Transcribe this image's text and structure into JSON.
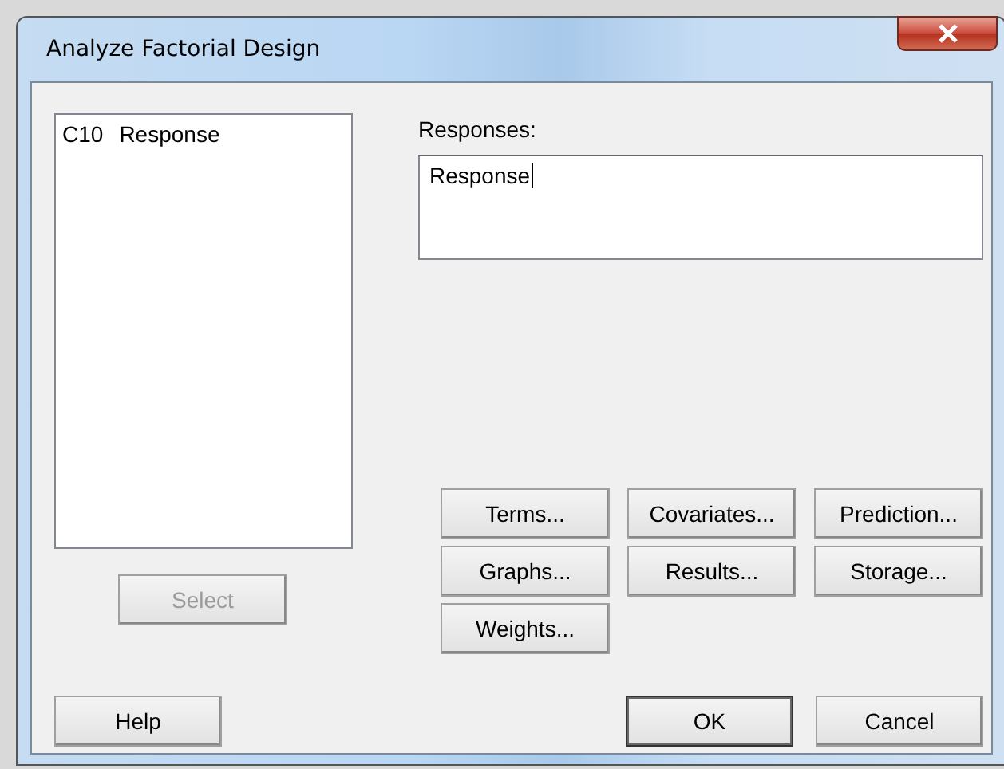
{
  "window": {
    "title": "Analyze Factorial Design"
  },
  "variables": [
    {
      "column": "C10",
      "name": "Response",
      "selected": false
    }
  ],
  "select_button": {
    "label": "Select",
    "disabled": true
  },
  "responses": {
    "label": "Responses:",
    "value": "Response"
  },
  "option_buttons": [
    {
      "label": "Terms..."
    },
    {
      "label": "Covariates..."
    },
    {
      "label": "Prediction..."
    },
    {
      "label": "Graphs..."
    },
    {
      "label": "Results..."
    },
    {
      "label": "Storage..."
    },
    {
      "label": "Weights..."
    }
  ],
  "help_button": {
    "label": "Help",
    "default": false
  },
  "footer_buttons": [
    {
      "label": "OK",
      "default": true
    },
    {
      "label": "Cancel",
      "default": false
    }
  ]
}
